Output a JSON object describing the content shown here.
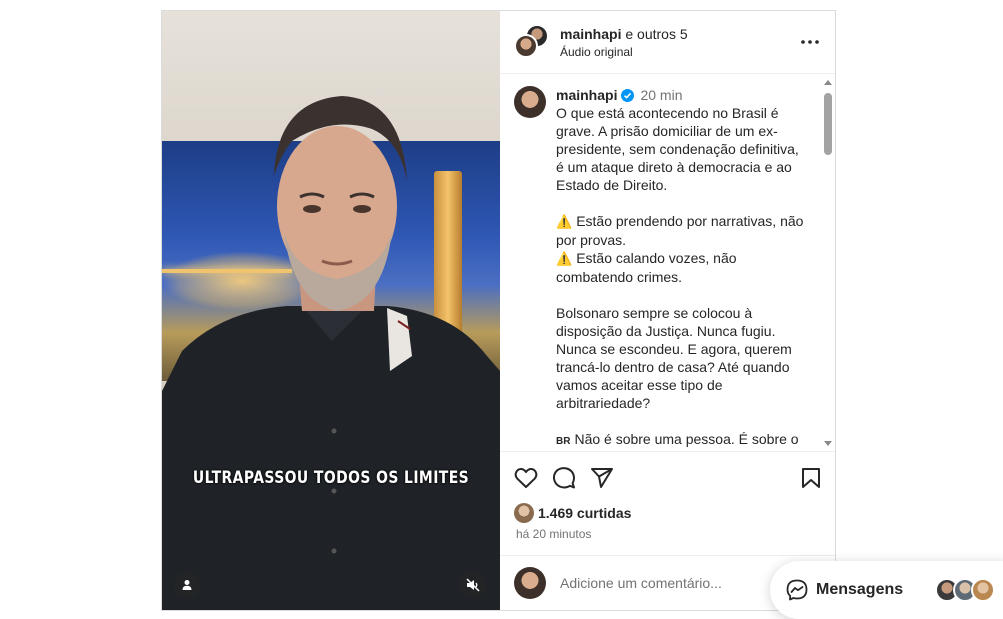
{
  "header": {
    "user": "mainhapi",
    "others": " e outros 5",
    "audio": "Áudio original"
  },
  "media": {
    "overlay_text": "ULTRAPASSOU TODOS OS LIMITES"
  },
  "caption": {
    "user": "mainhapi",
    "time": "20 min",
    "paragraphs": [
      "O que está acontecendo no Brasil é grave. A prisão domiciliar de um ex-presidente, sem condenação definitiva, é um ataque direto à democracia e ao Estado de Direito.",
      "Estão prendendo por narrativas, não por provas.",
      "Estão calando vozes, não combatendo crimes.",
      "Bolsonaro sempre se colocou à disposição da Justiça. Nunca fugiu. Nunca se escondeu. E agora, querem trancá-lo dentro de casa? Até quando vamos aceitar esse tipo de arbitrariedade?",
      "Não é sobre uma pessoa. É sobre o"
    ],
    "flag_label": "BR"
  },
  "engagement": {
    "likes": "1.469 curtidas",
    "ago": "há 20 minutos"
  },
  "comment": {
    "placeholder": "Adicione um comentário..."
  },
  "messages": {
    "label": "Mensagens"
  }
}
